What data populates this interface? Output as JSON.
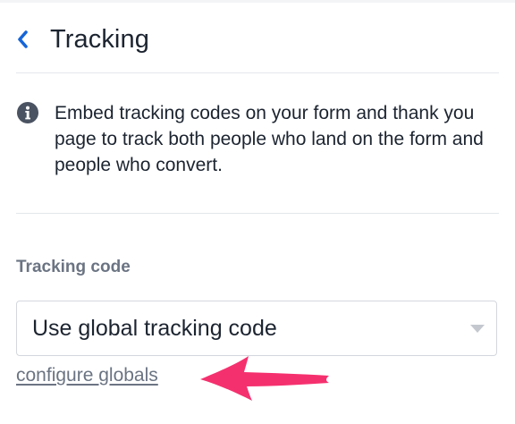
{
  "header": {
    "back_icon": "chevron-left-icon",
    "title": "Tracking"
  },
  "info": {
    "icon": "info-circle-icon",
    "text": "Embed tracking codes on your form and thank you page to track both people who land on the form and people who convert."
  },
  "tracking_code": {
    "label": "Tracking code",
    "selected_value": "Use global tracking code",
    "caret_icon": "caret-down-icon",
    "link_label": "configure globals"
  },
  "annotation": {
    "icon": "arrow-left-annotation",
    "color": "#f5306f"
  },
  "colors": {
    "accent": "#1565d8",
    "text": "#1c2430",
    "muted": "#6b7483",
    "border": "#d3d7dd"
  }
}
